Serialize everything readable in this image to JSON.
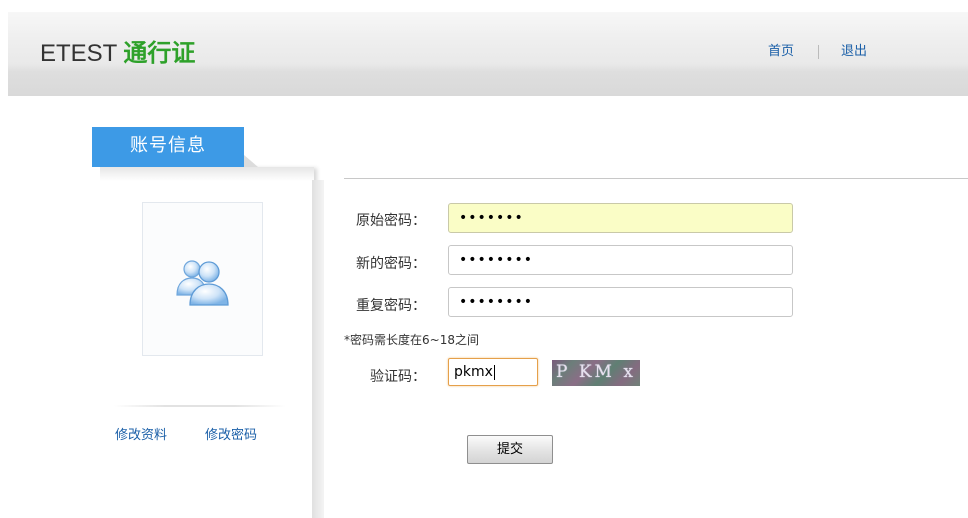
{
  "header": {
    "logo_brand": "ETEST",
    "logo_sub": "通行证",
    "nav": {
      "home": "首页",
      "logout": "退出"
    }
  },
  "sidebar": {
    "tab_title": "账号信息",
    "avatar_icon": "users-icon",
    "links": {
      "edit_profile": "修改资料",
      "change_password": "修改密码"
    }
  },
  "form": {
    "original_password": {
      "label": "原始密码：",
      "value": "•••••••"
    },
    "new_password": {
      "label": "新的密码：",
      "value": "••••••••"
    },
    "repeat_password": {
      "label": "重复密码：",
      "value": "••••••••"
    },
    "hint": "*密码需长度在6~18之间",
    "captcha": {
      "label": "验证码：",
      "value": "pkmx",
      "image_text": "P KM x"
    },
    "submit_label": "提交"
  },
  "colors": {
    "accent_blue": "#3d9ae6",
    "logo_green": "#2ea12a",
    "link_blue": "#1a5fa8",
    "autofill_yellow": "#fafdc6"
  }
}
